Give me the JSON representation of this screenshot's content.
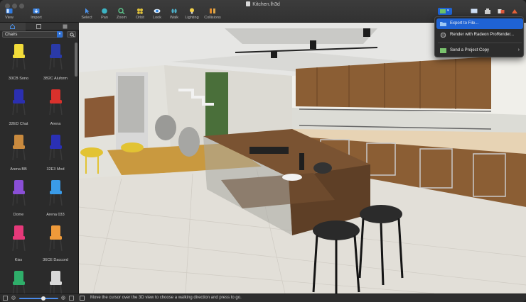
{
  "window": {
    "title": "Kitchen.lh3d"
  },
  "toolbar": {
    "view_label": "View",
    "import_label": "Import",
    "tools": [
      {
        "label": "Select",
        "icon": "arrow-cursor-icon"
      },
      {
        "label": "Pan",
        "icon": "hand-icon"
      },
      {
        "label": "Zoom",
        "icon": "zoom-icon"
      },
      {
        "label": "Orbit",
        "icon": "orbit-icon"
      },
      {
        "label": "Look",
        "icon": "eye-icon"
      },
      {
        "label": "Walk",
        "icon": "footprints-icon"
      },
      {
        "label": "Lighting",
        "icon": "bulb-icon"
      },
      {
        "label": "Collisions",
        "icon": "collisions-icon"
      }
    ]
  },
  "left_panel": {
    "category": "Chairs",
    "items": [
      {
        "label": "30CB Sono",
        "color": "#f2dc3a"
      },
      {
        "label": "3B2C Aluform",
        "color": "#2a3aa8"
      },
      {
        "label": "32ED Chat",
        "color": "#2b2fb0"
      },
      {
        "label": "Arena",
        "color": "#d9312c"
      },
      {
        "label": "Arena BB",
        "color": "#c98a3e"
      },
      {
        "label": "32E3 Mod",
        "color": "#2a30b4"
      },
      {
        "label": "Dome",
        "color": "#8a4fd6"
      },
      {
        "label": "Arena 033",
        "color": "#3a9be8"
      },
      {
        "label": "Kiss",
        "color": "#e6397a"
      },
      {
        "label": "36CE Daccord",
        "color": "#ef9a3a"
      },
      {
        "label": "",
        "color": "#2fae6a"
      },
      {
        "label": "",
        "color": "#d8d8d8"
      }
    ]
  },
  "export_menu": {
    "items": [
      {
        "label": "Export to File...",
        "icon": "folder-icon",
        "highlighted": true
      },
      {
        "label": "Render with Radeon ProRender...",
        "icon": "render-icon",
        "highlighted": false
      },
      {
        "label": "Send a Project Copy",
        "icon": "share-icon",
        "highlighted": false,
        "submenu": true
      }
    ]
  },
  "status_bar": {
    "message": "Move the cursor over the 3D view to choose a walking direction and press to go.",
    "zoom_level": 0.62
  },
  "colors": {
    "accent": "#1f63d4",
    "toolbar_bg": "#353535",
    "panel_bg": "#2b2b2b"
  }
}
